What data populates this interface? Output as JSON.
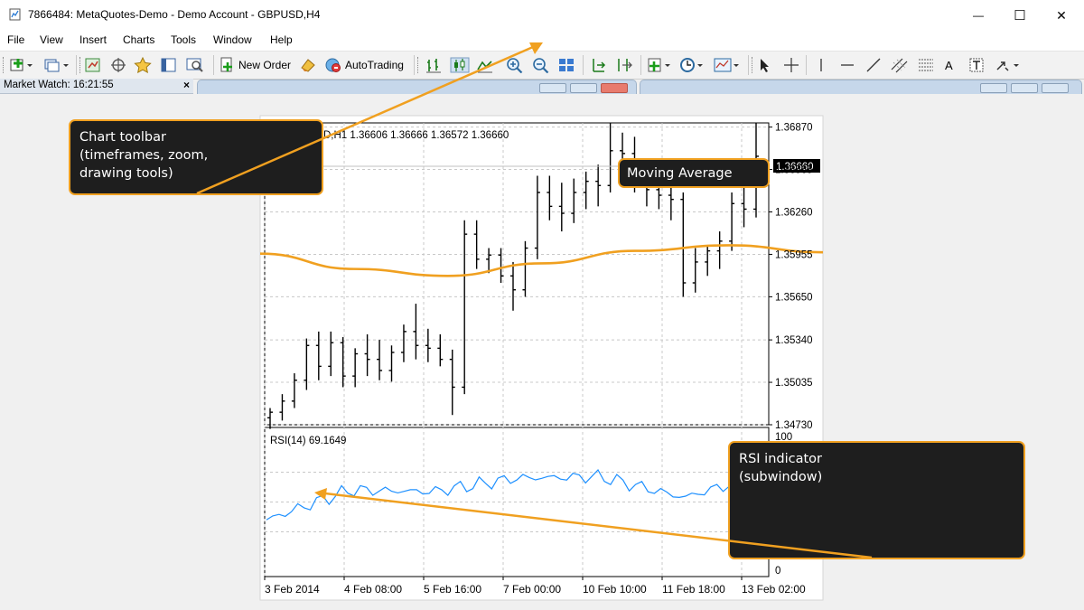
{
  "window": {
    "title": "7866484: MetaQuotes-Demo - Demo Account - GBPUSD,H4",
    "minimize_glyph": "—",
    "maximize_glyph": "☐",
    "close_glyph": "✕"
  },
  "menu": [
    "File",
    "View",
    "Insert",
    "Charts",
    "Tools",
    "Window",
    "Help"
  ],
  "toolbar": {
    "new_order_label": "New Order",
    "autotrading_label": "AutoTrading",
    "text_tool_label": "A",
    "icons": [
      "new-chart-icon",
      "profiles-icon",
      "market-watch-icon",
      "data-window-icon",
      "navigator-icon",
      "terminal-icon",
      "strategy-tester-icon",
      "new-order-icon",
      "metaeditor-icon",
      "autotrading-icon",
      "bar-chart-icon",
      "candlesticks-icon",
      "line-chart-icon",
      "zoom-in-icon",
      "zoom-out-icon",
      "tile-windows-icon",
      "auto-scroll-icon",
      "chart-shift-icon",
      "indicators-icon",
      "periods-icon",
      "templates-icon",
      "cursor-icon",
      "crosshair-icon",
      "vertical-line-icon",
      "horizontal-line-icon",
      "trendline-icon",
      "equidistant-channel-icon",
      "fibonacci-icon",
      "text-icon",
      "text-label-icon",
      "arrows-icon"
    ]
  },
  "market_watch": {
    "label": "Market Watch: 16:21:55",
    "close_glyph": "×"
  },
  "chart": {
    "header": "D,H1  1.36606 1.36666 1.36572 1.36660",
    "current_price": "1.36660",
    "price_ticks": [
      "1.36870",
      "1.36565",
      "1.36260",
      "1.35955",
      "1.35650",
      "1.35340",
      "1.35035",
      "1.34730"
    ],
    "rsi_label": "RSI(14) 69.1649",
    "rsi_ticks": [
      "100",
      "0"
    ],
    "time_labels": [
      "3 Feb 2014",
      "4 Feb 08:00",
      "5 Feb 16:00",
      "7 Feb 00:00",
      "10 Feb 10:00",
      "11 Feb 18:00",
      "13 Feb 02:00"
    ],
    "colors": {
      "ma": "#f0a020",
      "rsi": "#1e90ff",
      "bars": "#000000",
      "grid": "#c8c8c8",
      "callout_border": "#f0a020"
    }
  },
  "callouts": {
    "toolbar": [
      "Chart toolbar",
      "(timeframes, zoom,",
      "drawing tools)"
    ],
    "moving_average": "Moving Average",
    "rsi": [
      "RSI indicator",
      "(subwindow)"
    ]
  },
  "chart_data": {
    "type": "line",
    "title": "",
    "x": [
      "3 Feb 2014",
      "4 Feb 08:00",
      "5 Feb 16:00",
      "7 Feb 00:00",
      "10 Feb 10:00",
      "11 Feb 18:00",
      "13 Feb 02:00"
    ],
    "series": [
      {
        "name": "Moving Average",
        "values": [
          1.3596,
          1.3585,
          1.358,
          1.3589,
          1.3598,
          1.3602,
          1.3597
        ]
      },
      {
        "name": "RSI(14)",
        "values": [
          38,
          58,
          57,
          66,
          67,
          53,
          69
        ]
      }
    ],
    "bars": [
      [
        1.3478,
        1.3485,
        1.347,
        1.3482
      ],
      [
        1.3482,
        1.3495,
        1.3476,
        1.349
      ],
      [
        1.349,
        1.351,
        1.3485,
        1.3505
      ],
      [
        1.3505,
        1.3535,
        1.3498,
        1.353
      ],
      [
        1.353,
        1.354,
        1.3505,
        1.3515
      ],
      [
        1.3515,
        1.354,
        1.3508,
        1.3532
      ],
      [
        1.3532,
        1.3536,
        1.35,
        1.3508
      ],
      [
        1.3508,
        1.3528,
        1.35,
        1.3524
      ],
      [
        1.3524,
        1.3538,
        1.3508,
        1.352
      ],
      [
        1.352,
        1.3534,
        1.3505,
        1.3512
      ],
      [
        1.3512,
        1.353,
        1.3504,
        1.3525
      ],
      [
        1.3525,
        1.3545,
        1.3518,
        1.354
      ],
      [
        1.354,
        1.356,
        1.352,
        1.353
      ],
      [
        1.353,
        1.3542,
        1.3518,
        1.3528
      ],
      [
        1.3528,
        1.3538,
        1.3515,
        1.352
      ],
      [
        1.352,
        1.3527,
        1.348,
        1.35
      ],
      [
        1.35,
        1.362,
        1.3495,
        1.361
      ],
      [
        1.361,
        1.362,
        1.3585,
        1.3592
      ],
      [
        1.3592,
        1.36,
        1.3582,
        1.3595
      ],
      [
        1.3595,
        1.36,
        1.3575,
        1.358
      ],
      [
        1.358,
        1.359,
        1.3555,
        1.357
      ],
      [
        1.357,
        1.3605,
        1.3565,
        1.36
      ],
      [
        1.36,
        1.3652,
        1.3592,
        1.364
      ],
      [
        1.364,
        1.3652,
        1.362,
        1.363
      ],
      [
        1.363,
        1.3647,
        1.3612,
        1.3625
      ],
      [
        1.3625,
        1.365,
        1.3618,
        1.364
      ],
      [
        1.364,
        1.3655,
        1.3628,
        1.3648
      ],
      [
        1.3648,
        1.366,
        1.363,
        1.3645
      ],
      [
        1.3645,
        1.369,
        1.364,
        1.367
      ],
      [
        1.367,
        1.3683,
        1.365,
        1.3668
      ],
      [
        1.3668,
        1.368,
        1.364,
        1.365
      ],
      [
        1.365,
        1.3662,
        1.363,
        1.3642
      ],
      [
        1.3642,
        1.366,
        1.3628,
        1.3638
      ],
      [
        1.3638,
        1.365,
        1.362,
        1.3635
      ],
      [
        1.3635,
        1.364,
        1.3565,
        1.3575
      ],
      [
        1.3575,
        1.36,
        1.3568,
        1.359
      ],
      [
        1.359,
        1.3602,
        1.358,
        1.3598
      ],
      [
        1.3598,
        1.3612,
        1.3585,
        1.3605
      ],
      [
        1.3605,
        1.364,
        1.3598,
        1.3632
      ],
      [
        1.3632,
        1.3645,
        1.3615,
        1.3628
      ],
      [
        1.3628,
        1.369,
        1.3622,
        1.3666
      ]
    ],
    "ylim": [
      1.3473,
      1.369
    ],
    "rsi_ylim": [
      0,
      100
    ],
    "grid": true,
    "xlabel": "",
    "ylabel": ""
  }
}
